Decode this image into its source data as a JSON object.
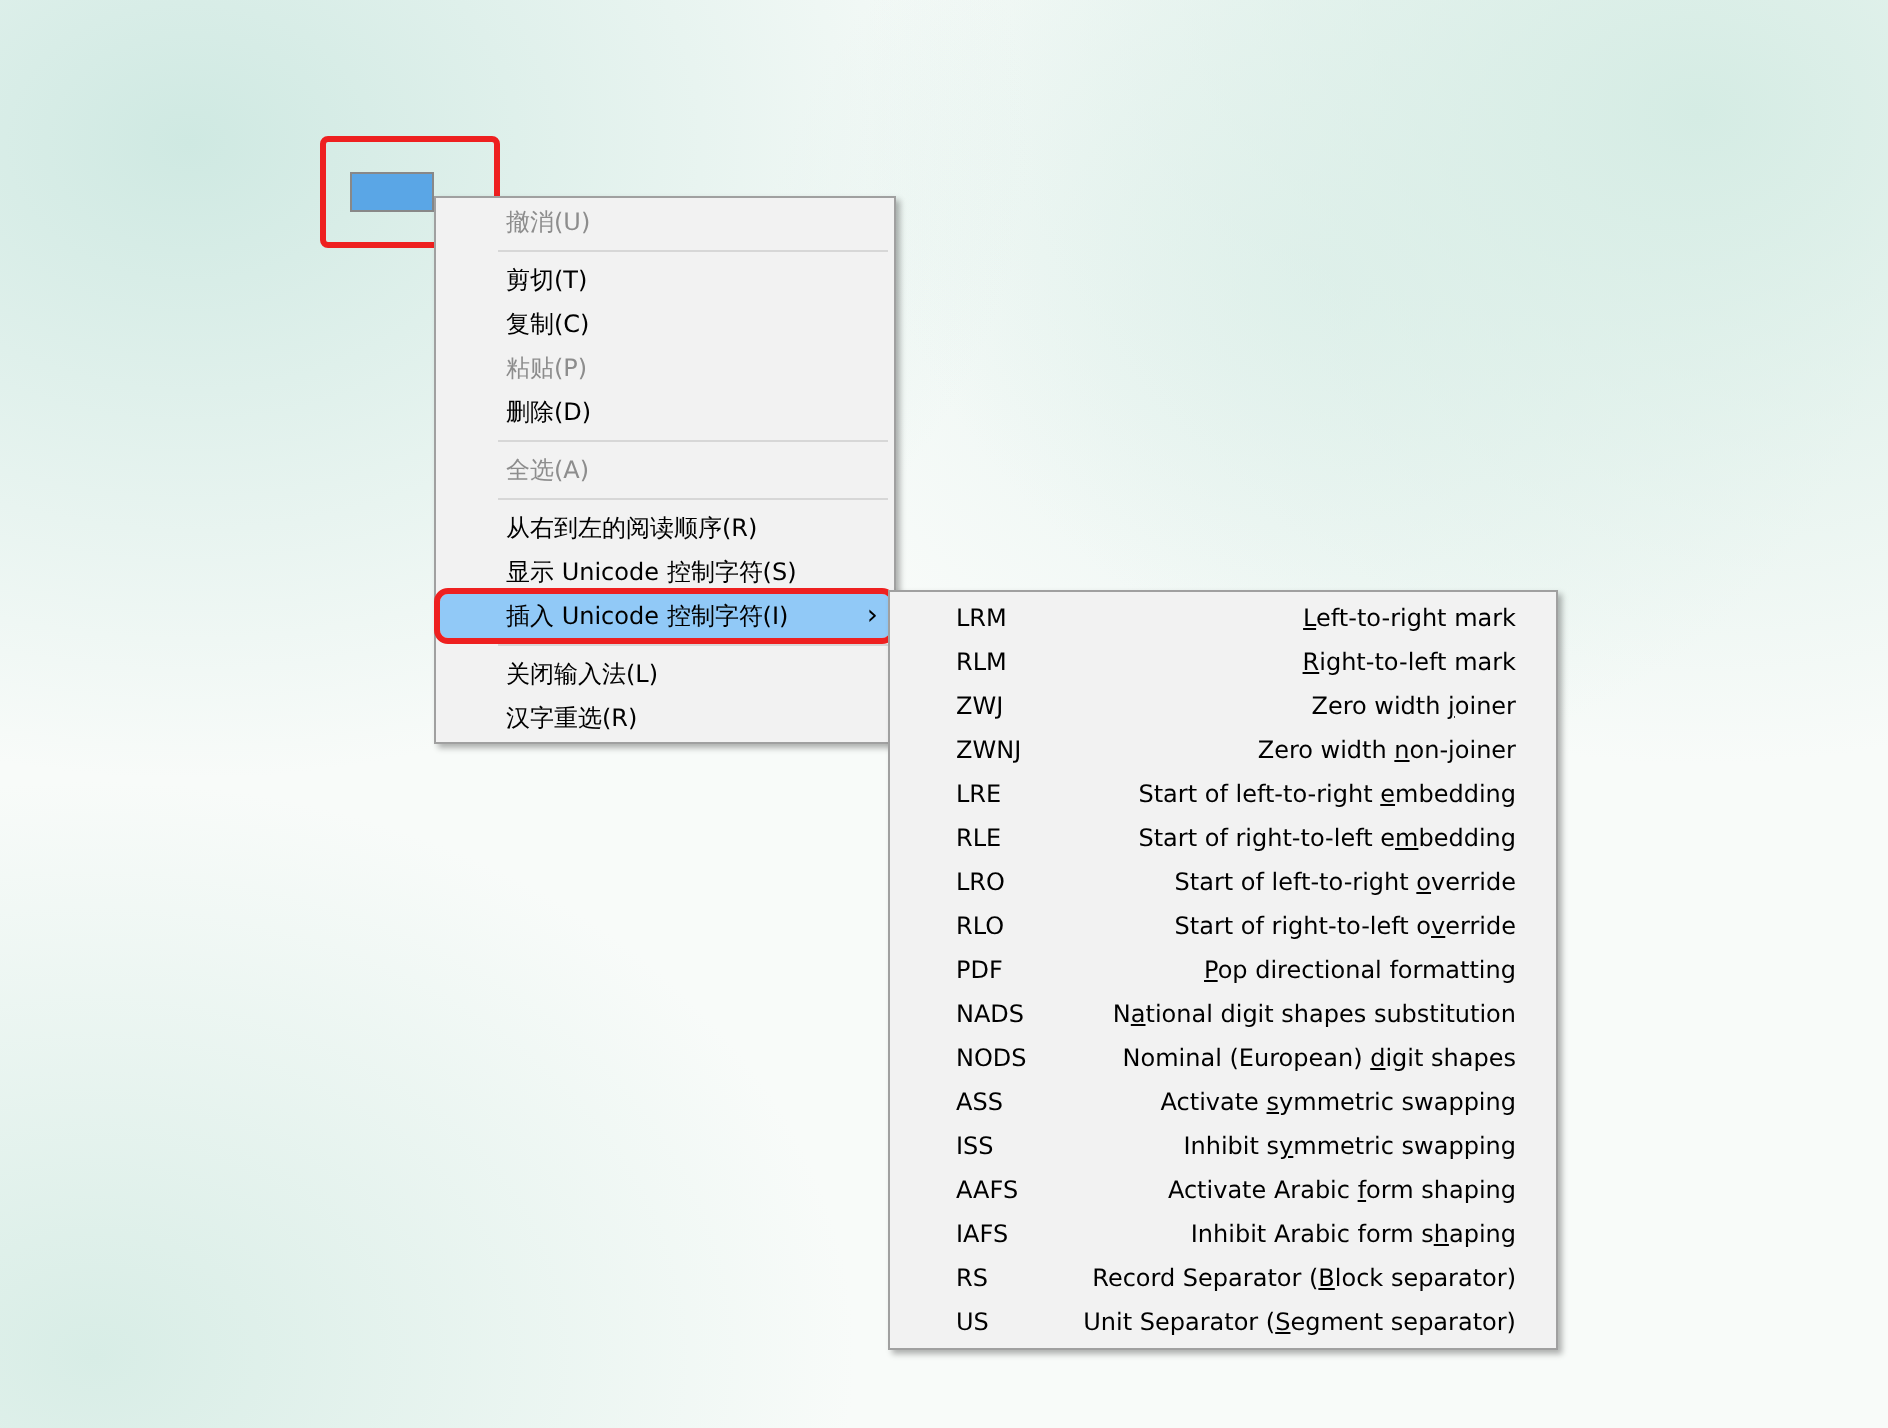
{
  "text_field": {
    "highlighted": true
  },
  "context_menu": {
    "items": [
      {
        "kind": "item",
        "label": "撤消(U)",
        "disabled": true,
        "selected": false,
        "highlighted": false
      },
      {
        "kind": "separator"
      },
      {
        "kind": "item",
        "label": "剪切(T)",
        "disabled": false,
        "selected": false,
        "highlighted": false
      },
      {
        "kind": "item",
        "label": "复制(C)",
        "disabled": false,
        "selected": false,
        "highlighted": false
      },
      {
        "kind": "item",
        "label": "粘贴(P)",
        "disabled": true,
        "selected": false,
        "highlighted": false
      },
      {
        "kind": "item",
        "label": "删除(D)",
        "disabled": false,
        "selected": false,
        "highlighted": false
      },
      {
        "kind": "separator"
      },
      {
        "kind": "item",
        "label": "全选(A)",
        "disabled": true,
        "selected": false,
        "highlighted": false
      },
      {
        "kind": "separator"
      },
      {
        "kind": "item",
        "label": "从右到左的阅读顺序(R)",
        "disabled": false,
        "selected": false,
        "highlighted": false
      },
      {
        "kind": "item",
        "label": "显示 Unicode 控制字符(S)",
        "disabled": false,
        "selected": false,
        "highlighted": false
      },
      {
        "kind": "submenu",
        "label": "插入 Unicode 控制字符(I)",
        "arrow": "›",
        "disabled": false,
        "selected": true,
        "highlighted": true
      },
      {
        "kind": "separator"
      },
      {
        "kind": "item",
        "label": "关闭输入法(L)",
        "disabled": false,
        "selected": false,
        "highlighted": false
      },
      {
        "kind": "item",
        "label": "汉字重选(R)",
        "disabled": false,
        "selected": false,
        "highlighted": false
      }
    ]
  },
  "submenu": {
    "items": [
      {
        "code": "LRM",
        "key": "L",
        "after": "eft-to-right mark"
      },
      {
        "code": "RLM",
        "key": "R",
        "after": "ight-to-left mark"
      },
      {
        "code": "ZWJ",
        "before": "Zero width ",
        "key": "j",
        "after": "oiner"
      },
      {
        "code": "ZWNJ",
        "before": "Zero width ",
        "key": "n",
        "after": "on-joiner"
      },
      {
        "code": "LRE",
        "before": "Start of left-to-right ",
        "key": "e",
        "after": "mbedding"
      },
      {
        "code": "RLE",
        "before": "Start of right-to-left e",
        "key": "m",
        "after": "bedding"
      },
      {
        "code": "LRO",
        "before": "Start of left-to-right ",
        "key": "o",
        "after": "verride"
      },
      {
        "code": "RLO",
        "before": "Start of right-to-left o",
        "key": "v",
        "after": "erride"
      },
      {
        "code": "PDF",
        "key": "P",
        "after": "op directional formatting"
      },
      {
        "code": "NADS",
        "before": "N",
        "key": "a",
        "after": "tional digit shapes substitution"
      },
      {
        "code": "NODS",
        "before": "Nominal (European) ",
        "key": "d",
        "after": "igit shapes"
      },
      {
        "code": "ASS",
        "before": "Activate ",
        "key": "s",
        "after": "ymmetric swapping"
      },
      {
        "code": "ISS",
        "before": "Inhibit s",
        "key": "y",
        "after": "mmetric swapping"
      },
      {
        "code": "AAFS",
        "before": "Activate Arabic ",
        "key": "f",
        "after": "orm shaping"
      },
      {
        "code": "IAFS",
        "before": "Inhibit Arabic form s",
        "key": "h",
        "after": "aping"
      },
      {
        "code": "RS",
        "before": "Record Separator (",
        "key": "B",
        "after": "lock separator)"
      },
      {
        "code": "US",
        "before": "Unit Separator (",
        "key": "S",
        "after": "egment separator)"
      }
    ]
  }
}
